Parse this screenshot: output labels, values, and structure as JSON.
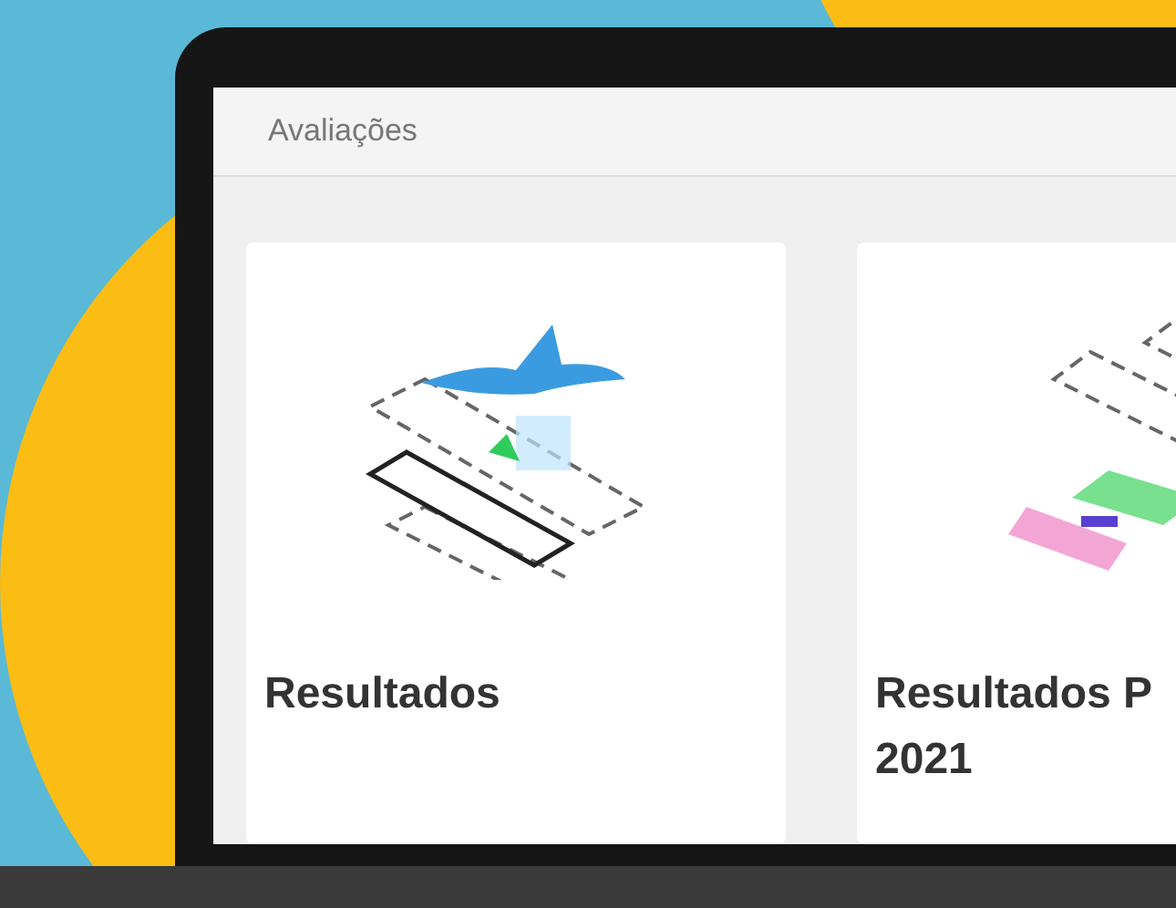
{
  "header": {
    "title": "Avaliações"
  },
  "cards": [
    {
      "title": "Resultados",
      "kind": "bird"
    },
    {
      "title": "Resultados P 2021",
      "kind": "shapes"
    }
  ]
}
